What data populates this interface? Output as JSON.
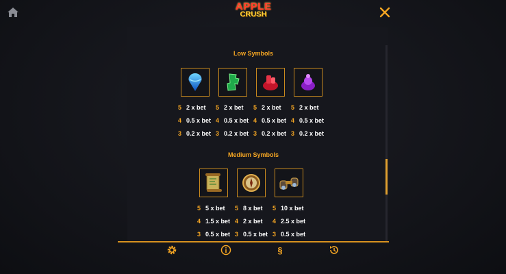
{
  "header": {
    "home_icon": "home-icon",
    "logo_line1": "APPLE",
    "logo_line2": "CRUSH",
    "close_icon": "close-icon"
  },
  "low": {
    "title": "Low Symbols",
    "symbols": [
      {
        "icon": "blue-gem-icon",
        "pays": [
          {
            "count": "5",
            "value": "2 x bet"
          },
          {
            "count": "4",
            "value": "0.5 x bet"
          },
          {
            "count": "3",
            "value": "0.2 x bet"
          }
        ]
      },
      {
        "icon": "green-gem-icon",
        "pays": [
          {
            "count": "5",
            "value": "2 x bet"
          },
          {
            "count": "4",
            "value": "0.5 x bet"
          },
          {
            "count": "3",
            "value": "0.2 x bet"
          }
        ]
      },
      {
        "icon": "red-gem-icon",
        "pays": [
          {
            "count": "5",
            "value": "2 x bet"
          },
          {
            "count": "4",
            "value": "0.5 x bet"
          },
          {
            "count": "3",
            "value": "0.2 x bet"
          }
        ]
      },
      {
        "icon": "purple-gem-icon",
        "pays": [
          {
            "count": "5",
            "value": "2 x bet"
          },
          {
            "count": "4",
            "value": "0.5 x bet"
          },
          {
            "count": "3",
            "value": "0.2 x bet"
          }
        ]
      }
    ]
  },
  "medium": {
    "title": "Medium Symbols",
    "symbols": [
      {
        "icon": "map-scroll-icon",
        "pays": [
          {
            "count": "5",
            "value": "5 x bet"
          },
          {
            "count": "4",
            "value": "1.5 x bet"
          },
          {
            "count": "3",
            "value": "0.5 x bet"
          }
        ]
      },
      {
        "icon": "compass-icon",
        "pays": [
          {
            "count": "5",
            "value": "8 x bet"
          },
          {
            "count": "4",
            "value": "2 x bet"
          },
          {
            "count": "3",
            "value": "0.5 x bet"
          }
        ]
      },
      {
        "icon": "binoculars-icon",
        "pays": [
          {
            "count": "5",
            "value": "10 x bet"
          },
          {
            "count": "4",
            "value": "2.5 x bet"
          },
          {
            "count": "3",
            "value": "0.5 x bet"
          }
        ]
      }
    ]
  },
  "bottom_bar": {
    "settings_icon": "gear-icon",
    "info_icon": "info-icon",
    "rules_label": "§",
    "history_icon": "history-icon"
  },
  "colors": {
    "accent": "#f5a623",
    "background": "#15161c",
    "frame": "#c98a1e"
  }
}
